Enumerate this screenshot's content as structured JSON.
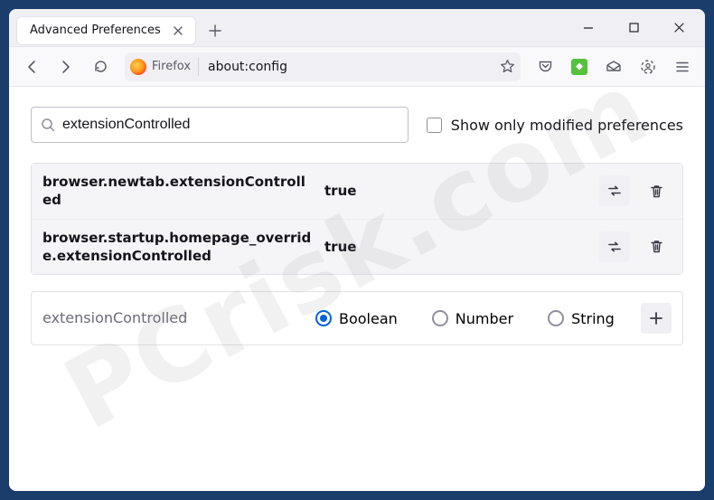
{
  "tab": {
    "title": "Advanced Preferences"
  },
  "address": {
    "identity": "Firefox",
    "url": "about:config"
  },
  "search": {
    "value": "extensionControlled",
    "checkbox_label": "Show only modified preferences"
  },
  "prefs": [
    {
      "name": "browser.newtab.extensionControlled",
      "value": "true"
    },
    {
      "name": "browser.startup.homepage_override.extensionControlled",
      "value": "true"
    }
  ],
  "newpref": {
    "name": "extensionControlled",
    "types": {
      "boolean": "Boolean",
      "number": "Number",
      "string": "String"
    },
    "selected": "boolean"
  },
  "watermark": "PCrisk.com"
}
